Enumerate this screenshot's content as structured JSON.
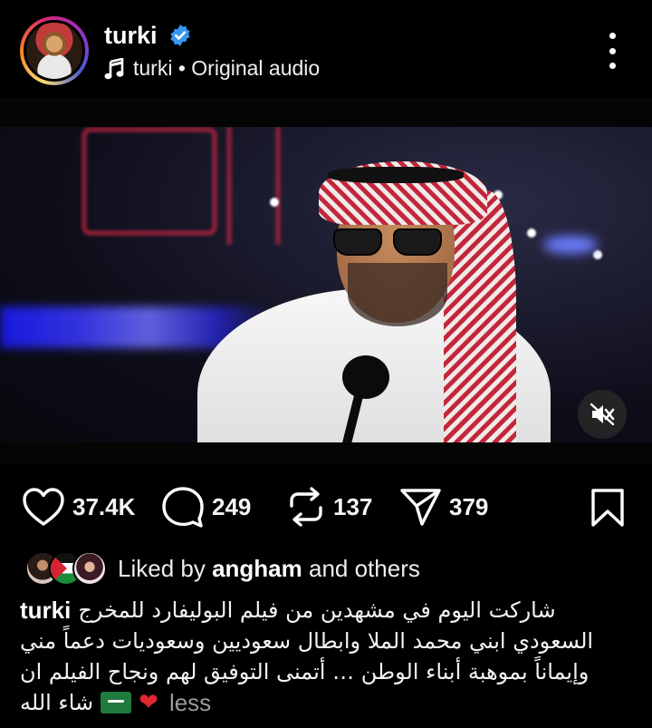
{
  "header": {
    "username": "turki",
    "verified_icon": "verified-badge-icon",
    "audio_icon": "music-note-icon",
    "audio_label": "turki • Original audio",
    "more_icon": "more-vertical-icon"
  },
  "video": {
    "mute_icon": "speaker-muted-icon"
  },
  "actions": {
    "like_count": "37.4K",
    "comment_count": "249",
    "repost_count": "137",
    "share_count": "379",
    "like_icon": "heart-icon",
    "comment_icon": "comment-bubble-icon",
    "repost_icon": "repost-icon",
    "share_icon": "paper-plane-icon",
    "save_icon": "bookmark-icon"
  },
  "likes": {
    "prefix": "Liked by ",
    "user": "angham",
    "suffix": " and others"
  },
  "caption": {
    "user": "turki",
    "line1": "شاركت اليوم في مشهدين من فيلم البوليفارد للمخرج",
    "line2": "السعودي ابني محمد الملا وابطال سعوديين وسعوديات دعماً مني",
    "line3": "وإيماناً بموهبة أبناء الوطن … أتمنى التوفيق لهم ونجاح الفيلم ان",
    "line4": "شاء الله",
    "less_label": "less"
  },
  "colors": {
    "background": "#000000",
    "text": "#f5f5f5",
    "verified": "#3897f0",
    "muted_text": "#9a9a9a"
  }
}
